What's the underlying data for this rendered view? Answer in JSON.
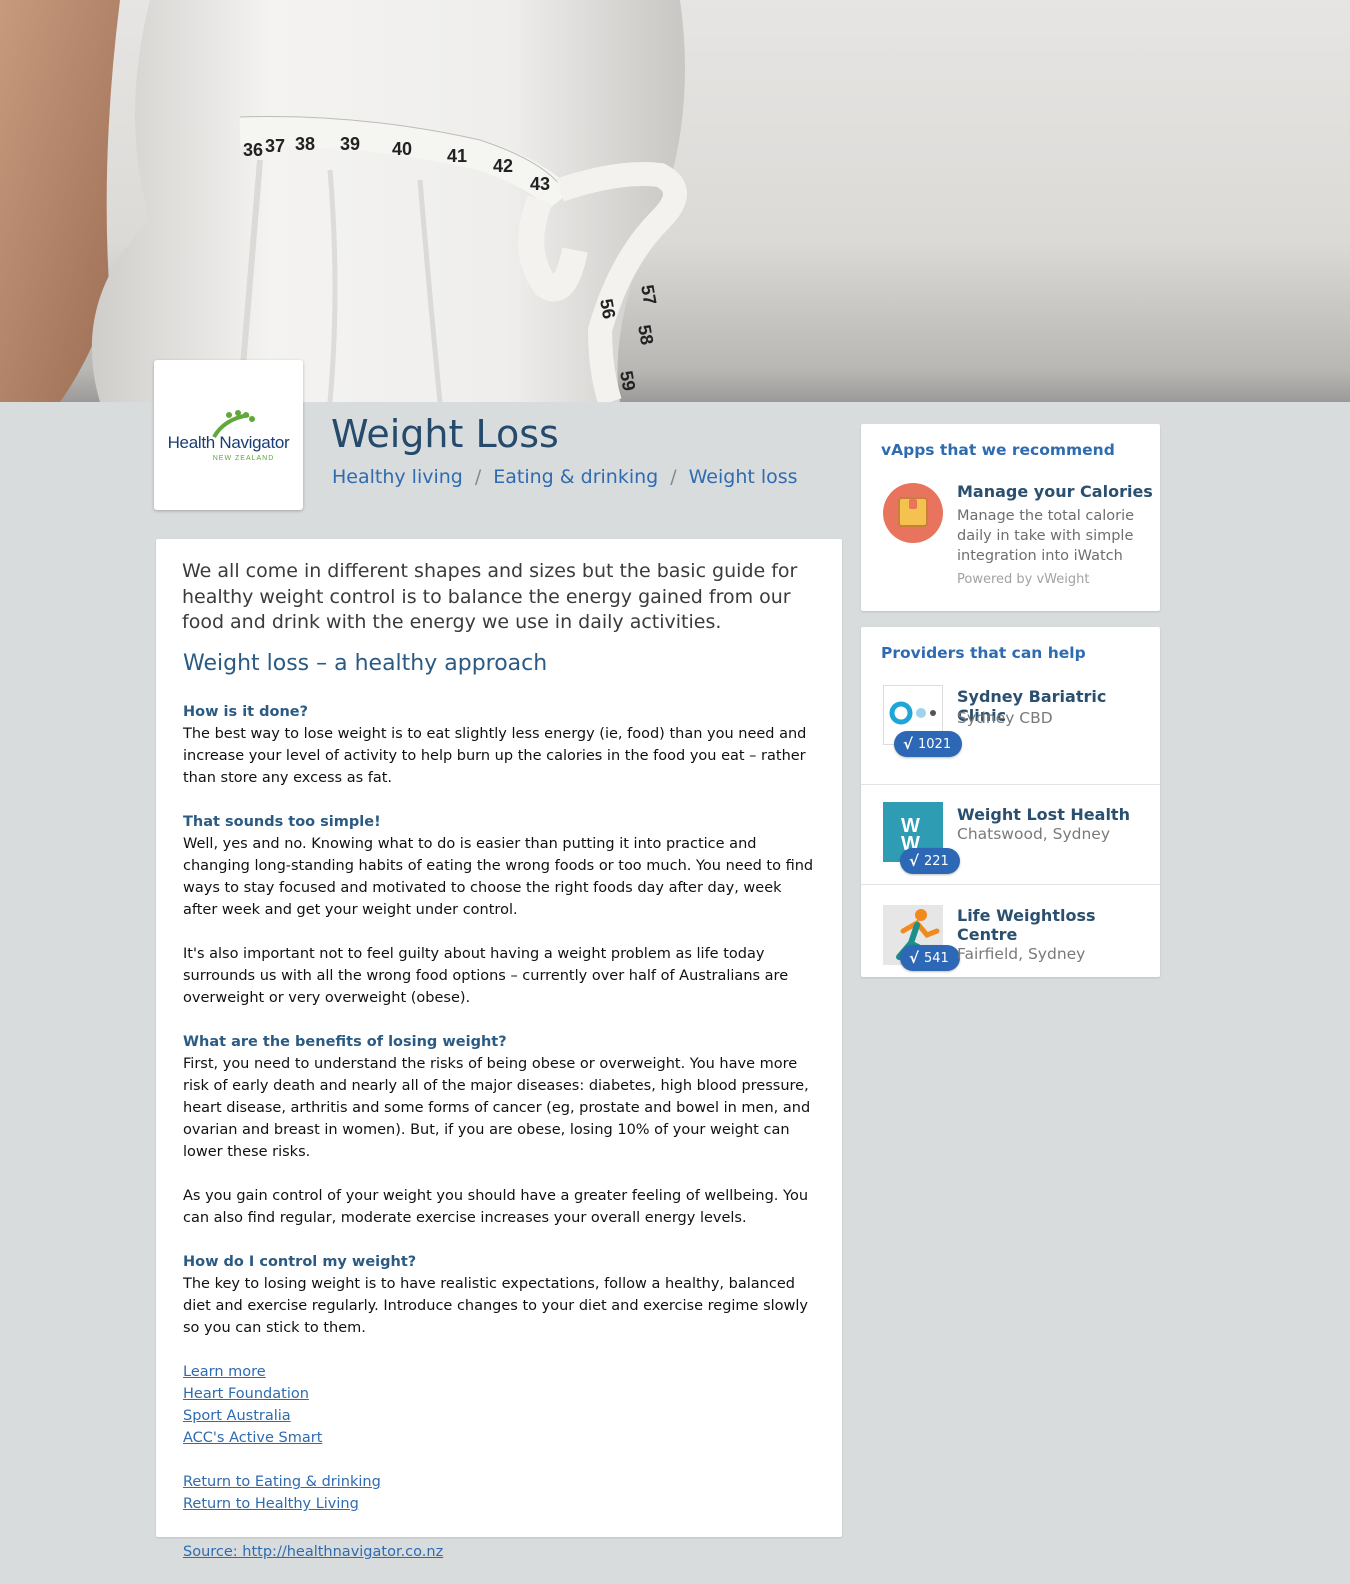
{
  "page": {
    "title": "Weight Loss",
    "breadcrumb": [
      "Healthy living",
      "Eating & drinking",
      "Weight loss"
    ]
  },
  "logo": {
    "name": "Health Navigator",
    "sub": "NEW ZEALAND"
  },
  "hero": {
    "tape_numbers": [
      "36",
      "37",
      "38",
      "39",
      "40",
      "41",
      "42",
      "43",
      "56",
      "57",
      "58",
      "59"
    ]
  },
  "article": {
    "intro": "We all come in different shapes and sizes but the basic guide for healthy weight control is to balance the energy gained from our food and drink with the energy we use in daily activities.",
    "subheading": "Weight loss – a healthy approach",
    "sections": [
      {
        "question": "How is it done?",
        "text": "The best way to lose weight is to eat slightly less energy (ie, food) than you need and increase your level of activity to help burn up the calories in the food you eat – rather than store any excess as fat."
      },
      {
        "question": "That sounds too simple!",
        "text": "Well, yes and no. Knowing what to do is easier than putting it into practice and changing long-standing habits of eating the wrong foods or too much. You need to find ways to stay focused and motivated to choose the right foods day after day, week after week and get your weight under control."
      },
      {
        "question": "",
        "text": "It's also important not to feel guilty about having a weight problem as life today surrounds us with all the wrong food options – currently over half of Australians are overweight or very overweight (obese)."
      },
      {
        "question": "What are the benefits of losing weight?",
        "text": "First, you need to understand the risks of being obese or overweight. You have more risk of early death and nearly all of the major diseases: diabetes, high blood pressure, heart disease, arthritis and some forms of cancer (eg, prostate and bowel in men, and ovarian and breast in women). But, if you are obese, losing 10% of your weight can lower these risks."
      },
      {
        "question": "",
        "text": "As you gain control of your weight you should have a greater feeling of wellbeing. You can also find regular, moderate exercise increases your overall energy levels."
      },
      {
        "question": "How do I control my weight?",
        "text": "The key to losing weight is to have realistic expectations, follow a healthy, balanced diet and exercise regularly. Introduce changes to your diet and exercise regime slowly so you can stick to them."
      }
    ],
    "links": [
      "Learn more",
      "Heart Foundation ",
      "Sport Australia",
      "ACC's Active Smart "
    ],
    "return_links": [
      "Return to Eating & drinking",
      "Return to Healthy Living"
    ],
    "source": "Source: http://healthnavigator.co.nz"
  },
  "vapps": {
    "heading": "vApps that we recommend",
    "items": [
      {
        "title": "Manage your Calories",
        "description": "Manage the total calorie daily in take with simple integration into iWatch",
        "powered_by": "Powered by vWeight",
        "icon": "scale-icon",
        "color": "#e8745e"
      }
    ]
  },
  "providers": {
    "heading": "Providers that can help",
    "items": [
      {
        "name": "Sydney Bariatric Clinic",
        "location": "Sydney CBD",
        "count": "1021",
        "logo": "circles-logo"
      },
      {
        "name": "Weight Lost Health",
        "location": "Chatswood, Sydney",
        "count": "221",
        "logo": "ww-logo"
      },
      {
        "name": "Life Weightloss Centre",
        "location": "Fairfield, Sydney",
        "count": "541",
        "logo": "runner-logo"
      }
    ],
    "badge_check": "√"
  },
  "colors": {
    "background": "#d9dcdd",
    "accent": "#2f6bb0",
    "heading_dark": "#254a6b",
    "badge": "#2d68b6"
  }
}
